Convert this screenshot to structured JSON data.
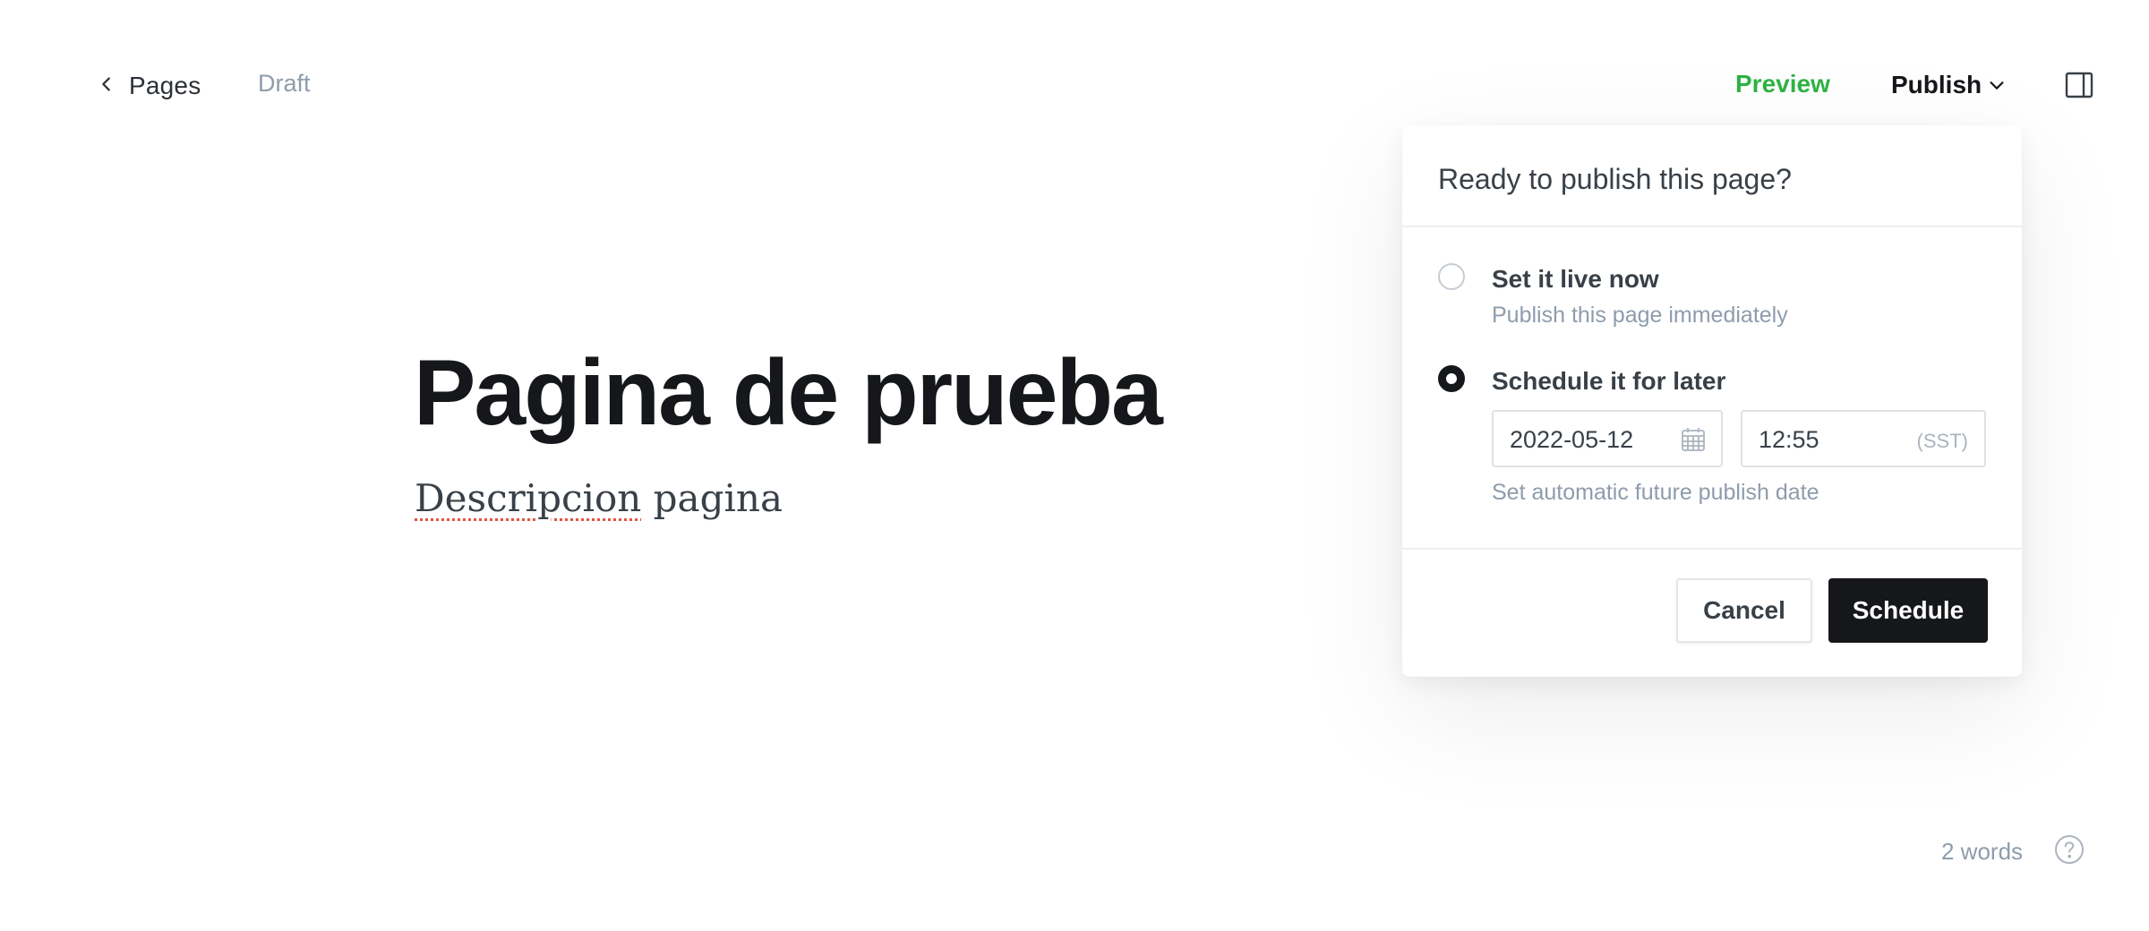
{
  "topbar": {
    "back_label": "Pages",
    "status": "Draft",
    "preview_label": "Preview",
    "publish_label": "Publish"
  },
  "editor": {
    "title": "Pagina de prueba",
    "excerpt_word1": "Descripcion",
    "excerpt_word2": " pagina"
  },
  "footer": {
    "word_count": "2 words"
  },
  "publish_popover": {
    "title": "Ready to publish this page?",
    "option_now": {
      "label": "Set it live now",
      "description": "Publish this page immediately",
      "selected": false
    },
    "option_later": {
      "label": "Schedule it for later",
      "selected": true,
      "date_value": "2022-05-12",
      "time_value": "12:55",
      "timezone": "(SST)",
      "hint": "Set automatic future publish date"
    },
    "cancel_label": "Cancel",
    "schedule_label": "Schedule"
  },
  "colors": {
    "accent_green": "#2fb344",
    "primary_dark": "#15171a",
    "muted_text": "#8e9cac",
    "spellcheck": "#e25440"
  },
  "icons": {
    "back": "chevron-left-icon",
    "publish_dropdown": "chevron-down-icon",
    "sidebar": "sidebar-panel-icon",
    "calendar": "calendar-icon",
    "help": "question-circle-icon"
  }
}
